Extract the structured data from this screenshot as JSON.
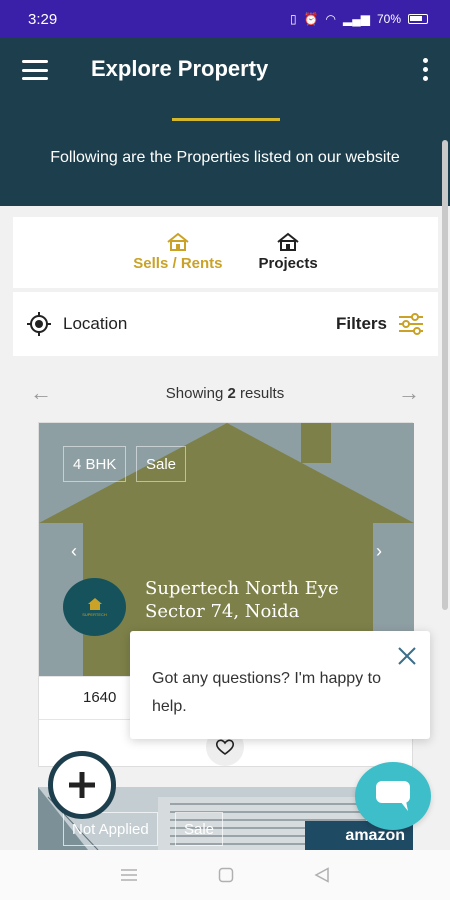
{
  "status_bar": {
    "time": "3:29",
    "battery": "70%"
  },
  "header": {
    "title": "Explore Property",
    "subtitle": "Following are the Properties listed on our website"
  },
  "tabs": [
    {
      "label": "Sells / Rents",
      "icon": "house-icon",
      "active": true
    },
    {
      "label": "Projects",
      "icon": "house-icon",
      "active": false
    }
  ],
  "filter_bar": {
    "location_label": "Location",
    "filters_label": "Filters"
  },
  "pagination": {
    "prefix": "Showing ",
    "count": "2",
    "suffix": " results"
  },
  "properties": [
    {
      "tags": [
        "4 BHK",
        "Sale"
      ],
      "title": "Supertech North Eye Sector 74, Noida",
      "logo_text": "SUPERTECH",
      "stat": "1640"
    },
    {
      "tags": [
        "Not Applied",
        "Sale"
      ],
      "banner_text": "amazon"
    }
  ],
  "chat": {
    "message": "Got any questions? I'm happy to help."
  },
  "colors": {
    "status_bar": "#3a1fa8",
    "header": "#1d3f4d",
    "accent": "#c9a227",
    "chat_fab": "#3dbec9"
  }
}
